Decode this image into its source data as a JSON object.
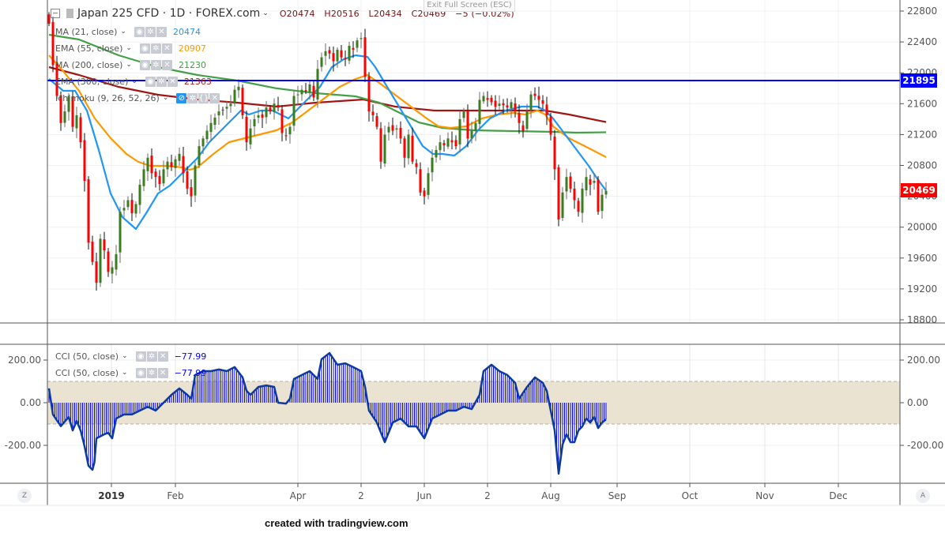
{
  "header": {
    "symbol": "Japan 225 CFD · 1D · FOREX.com",
    "open": "O20474",
    "high": "H20516",
    "low": "L20434",
    "close": "C20469",
    "change": "−5 (−0.02%)",
    "exit_fullscreen": "Exit Full Screen (ESC)"
  },
  "indicators": [
    {
      "label": "MA (21, close)",
      "value": "20474",
      "color": "#2196f3"
    },
    {
      "label": "EMA (55, close)",
      "value": "20907",
      "color": "#ff9800"
    },
    {
      "label": "MA (200, close)",
      "value": "21230",
      "color": "#43a047"
    },
    {
      "label": "EMA (300, close)",
      "value": "21363",
      "color": "#b71c1c"
    },
    {
      "label": "Ichimoku (9, 26, 52, 26)",
      "value": "",
      "color": "#888888"
    }
  ],
  "cci_legends": [
    {
      "label": "CCI (50, close)",
      "value": "−77.99"
    },
    {
      "label": "CCI (50, close)",
      "value": "−77.99"
    }
  ],
  "price_tags": {
    "hline": "21895",
    "last": "20469",
    "hline_color": "#0000ff",
    "last_color": "#ff0000"
  },
  "corner": {
    "left": "Z",
    "right": "A"
  },
  "credit": "created with tradingview.com",
  "chart_data": [
    {
      "type": "candlestick",
      "title": "Japan 225 CFD · 1D · FOREX.com",
      "y_ticks": [
        "22800",
        "22400",
        "22000",
        "21600",
        "21200",
        "20800",
        "20400",
        "20000",
        "19600",
        "19200",
        "18800"
      ],
      "ylim": [
        18800,
        22800
      ],
      "x_ticks": [
        {
          "label": "2019",
          "bar": 15.8,
          "bold": true
        },
        {
          "label": "Feb",
          "bar": 32
        },
        {
          "label": "Apr",
          "bar": 63
        },
        {
          "label": "2",
          "bar": 79
        },
        {
          "label": "Jun",
          "bar": 95
        },
        {
          "label": "2",
          "bar": 111
        },
        {
          "label": "Aug",
          "bar": 127
        },
        {
          "label": "Sep",
          "bar": 143.8
        },
        {
          "label": "Oct",
          "bar": 162.2
        },
        {
          "label": "Nov",
          "bar": 181.2
        },
        {
          "label": "Dec",
          "bar": 199.8
        }
      ],
      "horizontal_line": 21895,
      "closes": [
        22636,
        22100,
        21700,
        21350,
        21500,
        21700,
        21300,
        21450,
        21100,
        20600,
        19800,
        19550,
        19280,
        19850,
        19700,
        19420,
        19480,
        19650,
        20200,
        20250,
        20350,
        20180,
        20300,
        20550,
        20750,
        20900,
        20700,
        20650,
        20560,
        20750,
        20850,
        20780,
        20880,
        20950,
        20700,
        20500,
        20400,
        20800,
        21050,
        21150,
        21250,
        21350,
        21420,
        21500,
        21520,
        21560,
        21600,
        21780,
        21820,
        21450,
        21100,
        21280,
        21400,
        21450,
        21420,
        21550,
        21500,
        21600,
        21550,
        21220,
        21180,
        21300,
        21700,
        21720,
        21780,
        21760,
        21850,
        21680,
        22050,
        22200,
        22280,
        22250,
        22150,
        22300,
        22200,
        22180,
        22350,
        22300,
        22420,
        22450,
        21950,
        21500,
        21450,
        21300,
        20850,
        21200,
        21300,
        21250,
        21280,
        21150,
        20900,
        21200,
        20850,
        20780,
        20450,
        20400,
        20700,
        20900,
        21000,
        21100,
        21060,
        21150,
        21100,
        21050,
        21400,
        21500,
        21150,
        21250,
        21350,
        21650,
        21700,
        21650,
        21620,
        21560,
        21600,
        21580,
        21550,
        21620,
        21500,
        21350,
        21250,
        21500,
        21720,
        21700,
        21650,
        21600,
        21450,
        21200,
        20750,
        20100,
        20450,
        20650,
        20500,
        20350,
        20200,
        20500,
        20650,
        20550,
        20600,
        20200,
        20420,
        20469
      ],
      "series": [
        {
          "name": "MA (21, close)",
          "color": "#2196f3",
          "points": [
            [
              0,
              21920
            ],
            [
              3.6,
              21767
            ],
            [
              6.6,
              21767
            ],
            [
              9.6,
              21511
            ],
            [
              12.6,
              21000
            ],
            [
              15.6,
              20437
            ],
            [
              18.6,
              20130
            ],
            [
              22,
              19976
            ],
            [
              24.6,
              20181
            ],
            [
              27.6,
              20437
            ],
            [
              30.6,
              20539
            ],
            [
              34.6,
              20744
            ],
            [
              37.6,
              20897
            ],
            [
              40.6,
              21102
            ],
            [
              43.6,
              21255
            ],
            [
              46.6,
              21409
            ],
            [
              48.6,
              21511
            ],
            [
              50.6,
              21460
            ],
            [
              53.6,
              21511
            ],
            [
              56.6,
              21511
            ],
            [
              58.6,
              21460
            ],
            [
              60.6,
              21409
            ],
            [
              62.6,
              21511
            ],
            [
              65.6,
              21665
            ],
            [
              68.6,
              21818
            ],
            [
              71.6,
              22074
            ],
            [
              74.6,
              22176
            ],
            [
              77.6,
              22227
            ],
            [
              80.6,
              22207
            ],
            [
              82.6,
              22074
            ],
            [
              85.6,
              21818
            ],
            [
              88.6,
              21562
            ],
            [
              91.6,
              21306
            ],
            [
              94.6,
              21051
            ],
            [
              97.2,
              20948
            ],
            [
              99.6,
              20948
            ],
            [
              102.6,
              20928
            ],
            [
              105.6,
              21051
            ],
            [
              108.6,
              21255
            ],
            [
              111.6,
              21409
            ],
            [
              115.6,
              21511
            ],
            [
              119.6,
              21562
            ],
            [
              123.6,
              21562
            ],
            [
              125.6,
              21511
            ],
            [
              127.6,
              21409
            ],
            [
              130.6,
              21204
            ],
            [
              133.6,
              21000
            ],
            [
              136.6,
              20795
            ],
            [
              138.6,
              20641
            ],
            [
              141,
              20474
            ]
          ]
        },
        {
          "name": "EMA (55, close)",
          "color": "#ff9800",
          "points": [
            [
              0,
              22227
            ],
            [
              3.6,
              22023
            ],
            [
              7.6,
              21767
            ],
            [
              11.6,
              21409
            ],
            [
              15.6,
              21153
            ],
            [
              19.6,
              20948
            ],
            [
              22.6,
              20846
            ],
            [
              25.6,
              20795
            ],
            [
              29.6,
              20795
            ],
            [
              33.6,
              20775
            ],
            [
              35.6,
              20744
            ],
            [
              37.6,
              20775
            ],
            [
              41.6,
              20948
            ],
            [
              45.6,
              21102
            ],
            [
              49.6,
              21153
            ],
            [
              53.6,
              21204
            ],
            [
              57.6,
              21255
            ],
            [
              61.6,
              21358
            ],
            [
              65.6,
              21511
            ],
            [
              69.6,
              21665
            ],
            [
              73.6,
              21818
            ],
            [
              77.6,
              21920
            ],
            [
              80.6,
              21971
            ],
            [
              83.6,
              21869
            ],
            [
              87.6,
              21716
            ],
            [
              91.6,
              21562
            ],
            [
              95.6,
              21409
            ],
            [
              98.6,
              21306
            ],
            [
              101.6,
              21286
            ],
            [
              105.6,
              21306
            ],
            [
              109.6,
              21409
            ],
            [
              113.6,
              21460
            ],
            [
              117.6,
              21480
            ],
            [
              120.6,
              21460
            ],
            [
              123.6,
              21511
            ],
            [
              125.6,
              21460
            ],
            [
              127.6,
              21306
            ],
            [
              131.6,
              21153
            ],
            [
              135.6,
              21051
            ],
            [
              141,
              20907
            ]
          ]
        },
        {
          "name": "MA (200, close)",
          "color": "#43a047",
          "points": [
            [
              0,
              22493
            ],
            [
              7.6,
              22432
            ],
            [
              17.6,
              22227
            ],
            [
              27.6,
              22074
            ],
            [
              37.6,
              21971
            ],
            [
              47.6,
              21900
            ],
            [
              57.6,
              21798
            ],
            [
              67.6,
              21736
            ],
            [
              77.6,
              21695
            ],
            [
              83.6,
              21613
            ],
            [
              87.6,
              21511
            ],
            [
              93.6,
              21358
            ],
            [
              99.6,
              21286
            ],
            [
              107.6,
              21255
            ],
            [
              117.6,
              21245
            ],
            [
              127.6,
              21235
            ],
            [
              133.6,
              21225
            ],
            [
              141,
              21230
            ]
          ]
        },
        {
          "name": "EMA (300, close)",
          "color": "#a31515",
          "points": [
            [
              0,
              22074
            ],
            [
              7.6,
              21971
            ],
            [
              17.6,
              21818
            ],
            [
              27.6,
              21716
            ],
            [
              37.6,
              21654
            ],
            [
              47.6,
              21613
            ],
            [
              57.6,
              21562
            ],
            [
              67.6,
              21613
            ],
            [
              79.6,
              21654
            ],
            [
              87.6,
              21562
            ],
            [
              97.6,
              21511
            ],
            [
              107.6,
              21511
            ],
            [
              117.6,
              21511
            ],
            [
              125.6,
              21511
            ],
            [
              131.6,
              21460
            ],
            [
              141,
              21363
            ]
          ]
        }
      ]
    },
    {
      "type": "line+histogram",
      "title": "CCI (50, close)",
      "y_ticks": [
        "200.00",
        "0.00",
        "-200.00"
      ],
      "band": [
        -100,
        100
      ],
      "points": [
        [
          0,
          67
        ],
        [
          1,
          -55
        ],
        [
          3,
          -110
        ],
        [
          5,
          -67
        ],
        [
          6,
          -130
        ],
        [
          7,
          -85
        ],
        [
          8,
          -130
        ],
        [
          9,
          -204
        ],
        [
          10,
          -296
        ],
        [
          11,
          -315
        ],
        [
          11.5,
          -280
        ],
        [
          12,
          -167
        ],
        [
          14,
          -148
        ],
        [
          15,
          -141
        ],
        [
          16,
          -167
        ],
        [
          17,
          -74
        ],
        [
          19,
          -55
        ],
        [
          21,
          -55
        ],
        [
          23,
          -37
        ],
        [
          25,
          -19
        ],
        [
          27,
          -37
        ],
        [
          29,
          0
        ],
        [
          31,
          37
        ],
        [
          33,
          67
        ],
        [
          35,
          37
        ],
        [
          36,
          19
        ],
        [
          37,
          130
        ],
        [
          39,
          148
        ],
        [
          41,
          148
        ],
        [
          43,
          156
        ],
        [
          45,
          148
        ],
        [
          47,
          167
        ],
        [
          49,
          119
        ],
        [
          50,
          56
        ],
        [
          51,
          37
        ],
        [
          53,
          74
        ],
        [
          55,
          81
        ],
        [
          57,
          74
        ],
        [
          58,
          0
        ],
        [
          60,
          -4
        ],
        [
          61,
          19
        ],
        [
          62,
          111
        ],
        [
          64,
          130
        ],
        [
          66,
          148
        ],
        [
          68,
          111
        ],
        [
          69,
          204
        ],
        [
          71,
          233
        ],
        [
          73,
          178
        ],
        [
          75,
          185
        ],
        [
          77,
          167
        ],
        [
          79,
          148
        ],
        [
          80,
          74
        ],
        [
          81,
          -37
        ],
        [
          83,
          -93
        ],
        [
          85,
          -185
        ],
        [
          87,
          -93
        ],
        [
          89,
          -74
        ],
        [
          91,
          -111
        ],
        [
          93,
          -111
        ],
        [
          95,
          -167
        ],
        [
          97,
          -74
        ],
        [
          99,
          -56
        ],
        [
          101,
          -37
        ],
        [
          103,
          -37
        ],
        [
          105,
          -19
        ],
        [
          107,
          -30
        ],
        [
          109,
          37
        ],
        [
          110,
          148
        ],
        [
          112,
          178
        ],
        [
          114,
          148
        ],
        [
          116,
          130
        ],
        [
          118,
          93
        ],
        [
          119,
          19
        ],
        [
          121,
          74
        ],
        [
          123,
          119
        ],
        [
          125,
          93
        ],
        [
          126,
          56
        ],
        [
          127,
          -37
        ],
        [
          128,
          -130
        ],
        [
          129,
          -333
        ],
        [
          130,
          -196
        ],
        [
          131,
          -148
        ],
        [
          132,
          -185
        ],
        [
          133,
          -185
        ],
        [
          134,
          -130
        ],
        [
          135,
          -111
        ],
        [
          136,
          -74
        ],
        [
          137,
          -93
        ],
        [
          138,
          -67
        ],
        [
          139,
          -119
        ],
        [
          140,
          -93
        ],
        [
          141,
          -77.99
        ]
      ]
    }
  ]
}
